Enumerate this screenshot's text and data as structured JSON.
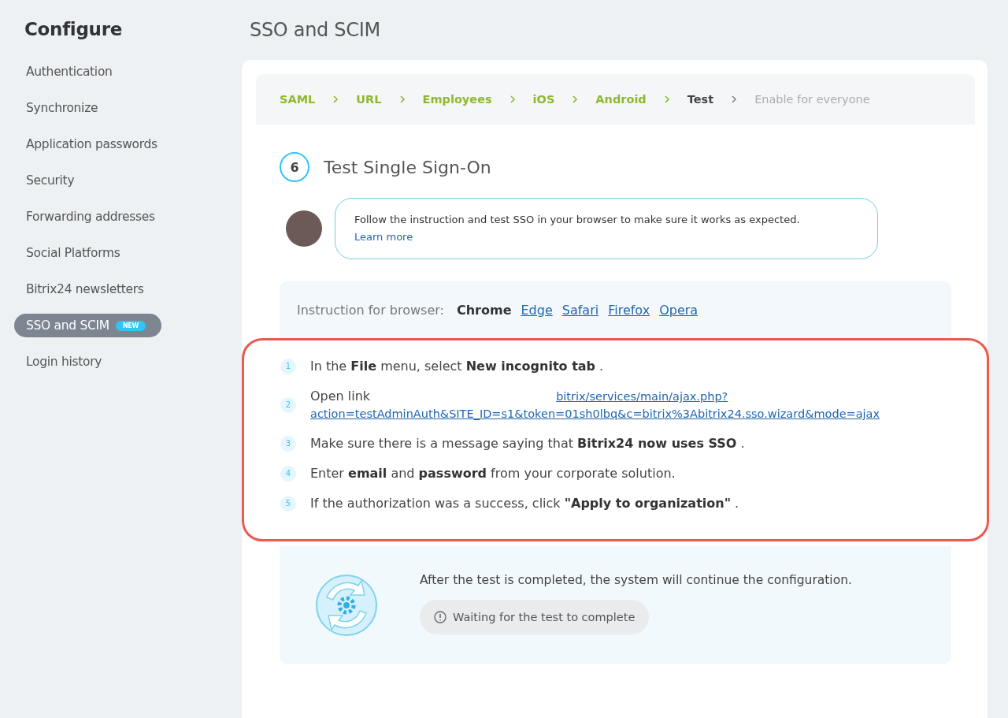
{
  "sidebar": {
    "title": "Configure",
    "items": [
      {
        "label": "Authentication",
        "selected": false
      },
      {
        "label": "Synchronize",
        "selected": false
      },
      {
        "label": "Application passwords",
        "selected": false
      },
      {
        "label": "Security",
        "selected": false
      },
      {
        "label": "Forwarding addresses",
        "selected": false
      },
      {
        "label": "Social Platforms",
        "selected": false
      },
      {
        "label": "Bitrix24 newsletters",
        "selected": false
      },
      {
        "label": "SSO and SCIM",
        "selected": true,
        "badge": "NEW"
      },
      {
        "label": "Login history",
        "selected": false
      }
    ]
  },
  "page_title": "SSO and SCIM",
  "wizard_steps": [
    {
      "label": "SAML",
      "done": true,
      "selected": false
    },
    {
      "label": "URL",
      "done": true,
      "selected": false
    },
    {
      "label": "Employees",
      "done": true,
      "selected": false
    },
    {
      "label": "iOS",
      "done": true,
      "selected": false
    },
    {
      "label": "Android",
      "done": true,
      "selected": false
    },
    {
      "label": "Test",
      "done": false,
      "selected": true
    },
    {
      "label": "Enable for everyone",
      "done": false,
      "selected": false
    }
  ],
  "step": {
    "number": "6",
    "title": "Test Single Sign-On"
  },
  "hint": {
    "text": "Follow the instruction and test SSO in your browser to make sure it works as expected.",
    "link": "Learn more"
  },
  "browsers": {
    "label": "Instruction for browser:",
    "tabs": [
      {
        "label": "Chrome",
        "selected": true
      },
      {
        "label": "Edge",
        "selected": false
      },
      {
        "label": "Safari",
        "selected": false
      },
      {
        "label": "Firefox",
        "selected": false
      },
      {
        "label": "Opera",
        "selected": false
      }
    ]
  },
  "instructions": [
    {
      "number": "1",
      "text": "In the  **File**  menu, select  **New incognito tab** ."
    },
    {
      "number": "2",
      "text": "Open link",
      "link_lines": [
        "bitrix/services/main/ajax.php?",
        "action=testAdminAuth&SITE_ID=s1&token=01sh0lbq&c=bitrix%3Abitrix24.sso.wizard&mode=ajax"
      ]
    },
    {
      "number": "3",
      "text": "Make sure there is a message saying that  **Bitrix24 now uses SSO** ."
    },
    {
      "number": "4",
      "text": "Enter  **email**  and   **password**   from your corporate solution."
    },
    {
      "number": "5",
      "text": "If the authorization was a success, click  **\"Apply to organization\"** ."
    }
  ],
  "status": {
    "message": "After the test is completed, the system will continue the configuration.",
    "badge": "Waiting for the test to complete"
  }
}
